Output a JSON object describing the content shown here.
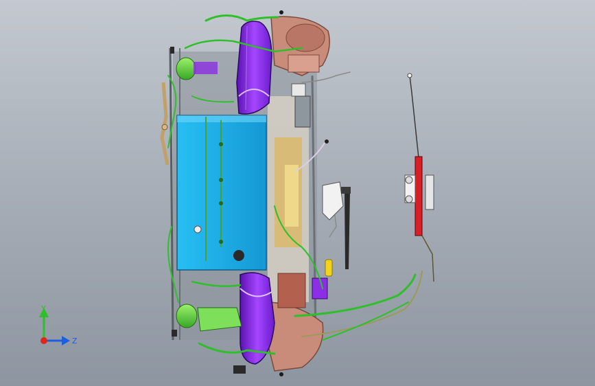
{
  "viewport": {
    "background_top": "#c4c9d0",
    "background_bottom": "#8d95a0"
  },
  "colors": {
    "battery_blue": "#1fb3ea",
    "harness_green": "#2fbf2a",
    "lime_green": "#7ee05a",
    "fender_purple": "#8b2ee6",
    "copper_pink": "#c98b7a",
    "frame_gray": "#6b6f76",
    "pump_red": "#d81f26",
    "yellow_cap": "#f2d21b"
  },
  "triad": {
    "y_label": "Y",
    "z_label": "Z",
    "y_color": "#2fbf2a",
    "z_color": "#1b5fe0",
    "x_color": "#e0261b",
    "y_icon": "y-axis-arrow-icon",
    "z_icon": "z-axis-arrow-icon"
  }
}
